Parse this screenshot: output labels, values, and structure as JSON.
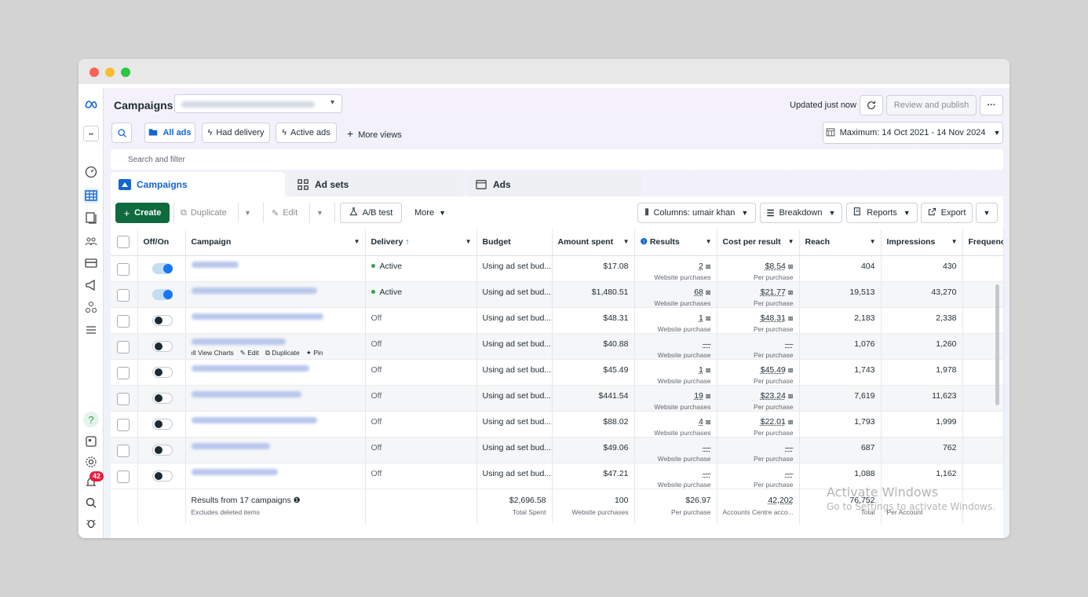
{
  "header": {
    "title": "Campaigns",
    "updated": "Updated just now",
    "review_publish": "Review and publish",
    "more": "···"
  },
  "views": {
    "all_ads": "All ads",
    "had_delivery": "Had delivery",
    "active_ads": "Active ads",
    "more_views": "More views",
    "date_range": "Maximum: 14 Oct 2021 - 14 Nov 2024"
  },
  "search": {
    "placeholder": "Search and filter"
  },
  "tabs": [
    "Campaigns",
    "Ad sets",
    "Ads"
  ],
  "toolbar": {
    "create": "Create",
    "duplicate": "Duplicate",
    "edit": "Edit",
    "ab_test": "A/B test",
    "more": "More",
    "columns": "Columns: umair khan",
    "breakdown": "Breakdown",
    "reports": "Reports",
    "export": "Export"
  },
  "table": {
    "columns": [
      "Off/On",
      "Campaign",
      "Delivery",
      "Budget",
      "Amount spent",
      "Results",
      "Cost per result",
      "Reach",
      "Impressions",
      "Frequenc"
    ],
    "row_actions": [
      "View Charts",
      "Edit",
      "Duplicate",
      "Pin"
    ],
    "rows": [
      {
        "on": true,
        "delivery": "Active",
        "budget": "Using ad set bud...",
        "spent": "$17.08",
        "results": "2",
        "results_sub": "Website purchases",
        "cpr": "$8.54",
        "cpr_sub": "Per purchase",
        "reach": "404",
        "impressions": "430"
      },
      {
        "on": true,
        "delivery": "Active",
        "budget": "Using ad set bud...",
        "spent": "$1,480.51",
        "results": "68",
        "results_sub": "Website purchases",
        "cpr": "$21.77",
        "cpr_sub": "Per purchase",
        "reach": "19,513",
        "impressions": "43,270"
      },
      {
        "on": false,
        "delivery": "Off",
        "budget": "Using ad set bud...",
        "spent": "$48.31",
        "results": "1",
        "results_sub": "Website purchase",
        "cpr": "$48.31",
        "cpr_sub": "Per purchase",
        "reach": "2,183",
        "impressions": "2,338"
      },
      {
        "on": false,
        "delivery": "Off",
        "budget": "Using ad set bud...",
        "spent": "$40.88",
        "results": "—",
        "results_sub": "Website purchase",
        "cpr": "—",
        "cpr_sub": "Per purchase",
        "reach": "1,076",
        "impressions": "1,260"
      },
      {
        "on": false,
        "delivery": "Off",
        "budget": "Using ad set bud...",
        "spent": "$45.49",
        "results": "1",
        "results_sub": "Website purchase",
        "cpr": "$45.49",
        "cpr_sub": "Per purchase",
        "reach": "1,743",
        "impressions": "1,978"
      },
      {
        "on": false,
        "delivery": "Off",
        "budget": "Using ad set bud...",
        "spent": "$441.54",
        "results": "19",
        "results_sub": "Website purchases",
        "cpr": "$23.24",
        "cpr_sub": "Per purchase",
        "reach": "7,619",
        "impressions": "11,623"
      },
      {
        "on": false,
        "delivery": "Off",
        "budget": "Using ad set bud...",
        "spent": "$88.02",
        "results": "4",
        "results_sub": "Website purchases",
        "cpr": "$22.01",
        "cpr_sub": "Per purchase",
        "reach": "1,793",
        "impressions": "1,999"
      },
      {
        "on": false,
        "delivery": "Off",
        "budget": "Using ad set bud...",
        "spent": "$49.06",
        "results": "—",
        "results_sub": "Website purchase",
        "cpr": "—",
        "cpr_sub": "Per purchase",
        "reach": "687",
        "impressions": "762"
      },
      {
        "on": false,
        "delivery": "Off",
        "budget": "Using ad set bud...",
        "spent": "$47.21",
        "results": "—",
        "results_sub": "Website purchase",
        "cpr": "—",
        "cpr_sub": "Per purchase",
        "reach": "1,088",
        "impressions": "1,162"
      }
    ],
    "footer": {
      "label": "Results from 17 campaigns",
      "label_sub": "Excludes deleted items",
      "spent": "$2,696.58",
      "spent_sub": "Total Spent",
      "results": "100",
      "results_sub": "Website purchases",
      "cpr": "$26.97",
      "cpr_sub": "Per purchase",
      "reach": "42,202",
      "reach_sub": "Accounts Centre acco...",
      "impressions": "76,752",
      "impressions_sub": "Total",
      "frequency_sub": "Per Account"
    }
  },
  "sidebar": {
    "notification_count": "42"
  },
  "watermark": {
    "line1": "Activate Windows",
    "line2": "Go to Settings to activate Windows."
  },
  "colors": {
    "accent": "#1466d2",
    "create": "#0f6a3d",
    "toggle_on": "#1877f2",
    "active_dot": "#31a24c"
  }
}
